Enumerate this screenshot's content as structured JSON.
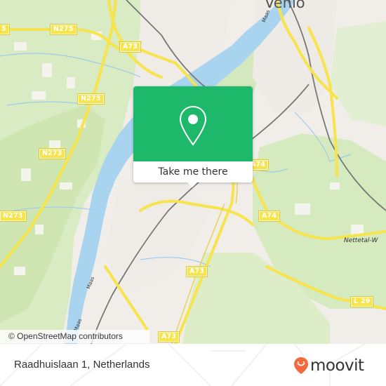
{
  "map": {
    "place_labels": [
      {
        "text": "Venlo"
      },
      {
        "text": "Nettetal-W"
      }
    ],
    "road_shields": [
      {
        "text": "N275"
      },
      {
        "text": "A73"
      },
      {
        "text": "N273"
      },
      {
        "text": "N273"
      },
      {
        "text": "N273"
      },
      {
        "text": "A74"
      },
      {
        "text": "A74"
      },
      {
        "text": "A73"
      },
      {
        "text": "A73"
      },
      {
        "text": "L 29"
      },
      {
        "text": "5"
      }
    ],
    "water_labels": [
      {
        "text": "Maas"
      },
      {
        "text": "Maas"
      },
      {
        "text": "Maas"
      }
    ],
    "colors": {
      "land": "#f1eeea",
      "green": "#d9ebc3",
      "water": "#a9d4ef",
      "motorway": "#f7e34c",
      "rail": "#777777"
    }
  },
  "attribution": "© OpenStreetMap contributors",
  "popup": {
    "icon": "map-pin-icon",
    "cta_label": "Take me there",
    "accent": "#1eb86a"
  },
  "footer": {
    "address": "Raadhuislaan 1, Netherlands",
    "brand_name": "moovit",
    "brand_color": "#f26a3d"
  }
}
